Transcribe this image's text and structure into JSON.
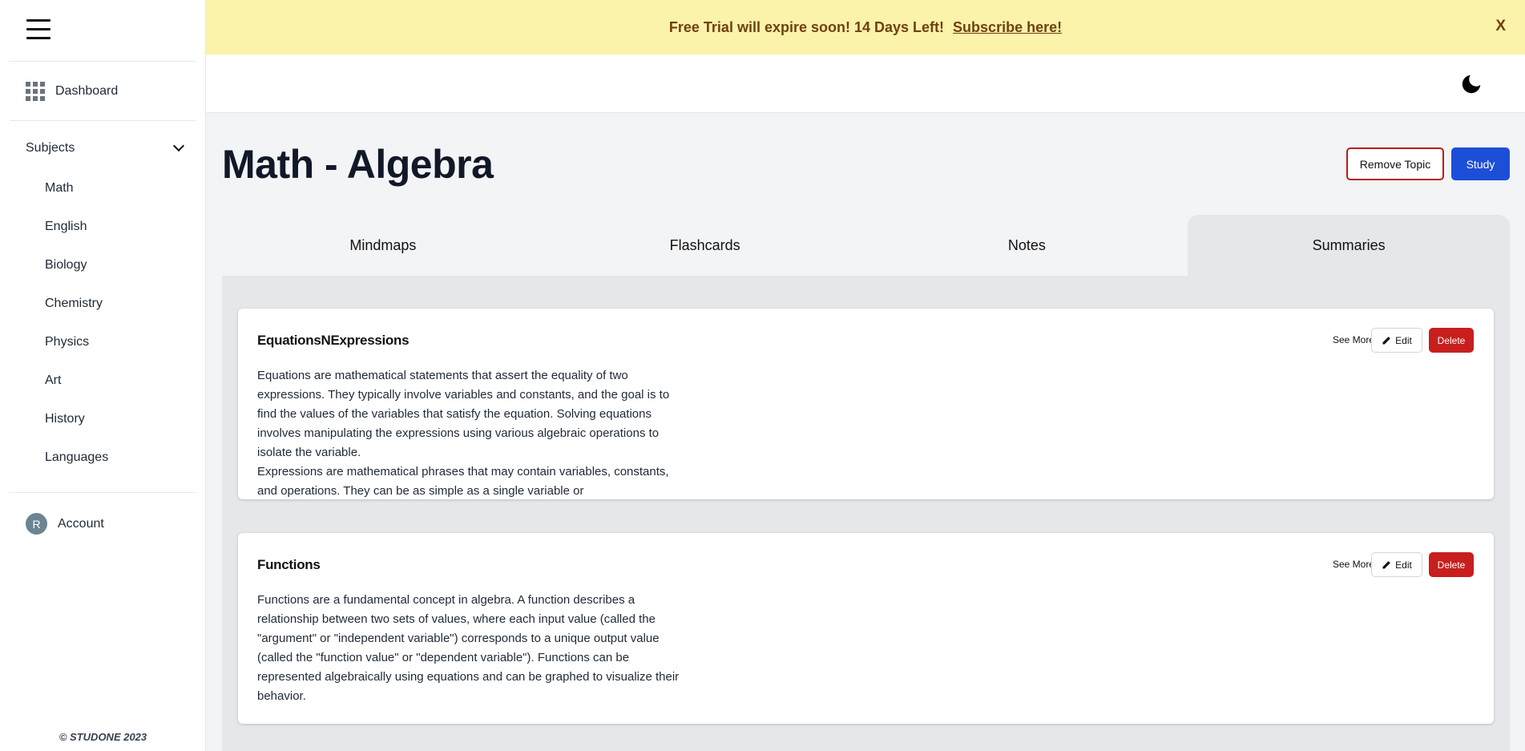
{
  "banner": {
    "text": "Free Trial will expire soon! 14 Days Left!",
    "link": "Subscribe here!",
    "close": "X"
  },
  "sidebar": {
    "dashboard": "Dashboard",
    "subjects_label": "Subjects",
    "subjects": [
      "Math",
      "English",
      "Biology",
      "Chemistry",
      "Physics",
      "Art",
      "History",
      "Languages"
    ],
    "account": "Account",
    "avatar_initial": "R",
    "copyright": "© STUDONE 2023"
  },
  "main": {
    "title": "Math - Algebra",
    "remove_topic": "Remove Topic",
    "study": "Study",
    "tabs": [
      "Mindmaps",
      "Flashcards",
      "Notes",
      "Summaries"
    ],
    "active_tab": "Summaries"
  },
  "cards": [
    {
      "title": "EquationsNExpressions",
      "body": "Equations are mathematical statements that assert the equality of two expressions. They typically involve variables and constants, and the goal is to find the values of the variables that satisfy the equation. Solving equations involves manipulating the expressions using various algebraic operations to isolate the variable.\nExpressions are mathematical phrases that may contain variables, constants, and operations. They can be as simple as a single variable or",
      "see_more": "See More",
      "edit": "Edit",
      "delete": "Delete"
    },
    {
      "title": "Functions",
      "body": "Functions are a fundamental concept in algebra. A function describes a relationship between two sets of values, where each input value (called the \"argument\" or \"independent variable\") corresponds to a unique output value (called the \"function value\" or \"dependent variable\"). Functions can be represented algebraically using equations and can be graphed to visualize their behavior.",
      "see_more": "See More",
      "edit": "Edit",
      "delete": "Delete"
    }
  ],
  "colors": {
    "banner_bg": "#fbf3aa",
    "primary": "#1d4ed8",
    "danger": "#c81e1e"
  },
  "icons": [
    "menu-icon",
    "dashboard-grid-icon",
    "chevron-down-icon",
    "moon-icon",
    "pencil-icon"
  ]
}
